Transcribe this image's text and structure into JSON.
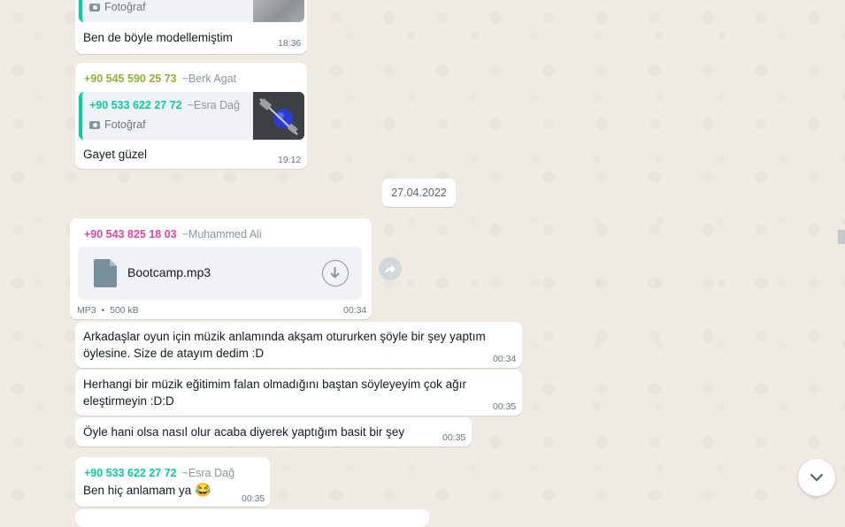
{
  "date_chip": "27.04.2022",
  "colors": {
    "sender_green_olive": "#8fb339",
    "sender_teal": "#06cf9c",
    "sender_pink": "#e542a3",
    "background": "#efeae2"
  },
  "messages": {
    "m1": {
      "quote_type": "Fotoğraf",
      "text": "Ben de böyle modellemiştim",
      "time": "18:36"
    },
    "m2": {
      "sender_phone": "+90 545 590 25 73",
      "sender_alias": "~Berk Agat",
      "quote_phone": "+90 533 622 27 72",
      "quote_alias": "~Esra Dağ",
      "quote_type": "Fotoğraf",
      "text": "Gayet güzel",
      "time": "19:12"
    },
    "m3": {
      "sender_phone": "+90 543 825 18 03",
      "sender_alias": "~Muhammed Ali",
      "file_name": "Bootcamp.mp3",
      "file_type": "MP3",
      "file_size": "500 kB",
      "time": "00:34"
    },
    "m4": {
      "line1": "Arkadaşlar oyun için müzik anlamında akşam otururken şöyle bir şey yaptım",
      "line2": "öylesine. Size de atayım dedim :D",
      "time": "00:34"
    },
    "m5": {
      "line1": "Herhangi bir müzik eğitimim falan olmadığını baştan söyleyeyim çok ağır",
      "line2": "eleştirmeyin :D:D",
      "time": "00:35"
    },
    "m6": {
      "text": "Öyle hani olsa nasıl olur acaba diyerek yaptığım basit bir şey",
      "time": "00:35"
    },
    "m7": {
      "sender_phone": "+90 533 622 27 72",
      "sender_alias": "~Esra Dağ",
      "text": "Ben hiç anlamam ya",
      "emoji": "😂",
      "time": "00:35"
    }
  },
  "icons": [
    "camera-icon",
    "document-icon",
    "download-icon",
    "forward-icon",
    "chevron-down-icon"
  ]
}
